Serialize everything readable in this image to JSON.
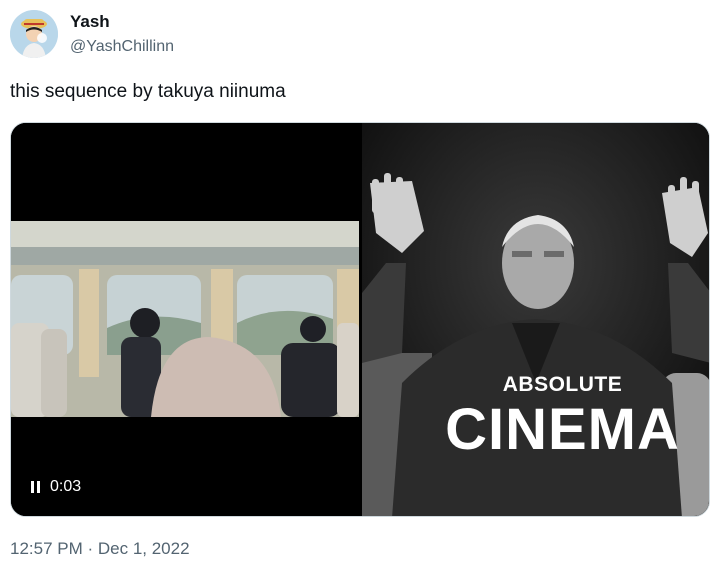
{
  "author": {
    "display_name": "Yash",
    "handle": "@YashChillinn"
  },
  "tweet": {
    "text": "this sequence by takuya niinuma",
    "timestamp": "12:57 PM · Dec 1, 2022"
  },
  "media": {
    "left": {
      "elapsed": "0:03",
      "control_icon": "pause-icon"
    },
    "right": {
      "caption_small": "ABSOLUTE",
      "caption_big": "CINEMA"
    }
  },
  "colors": {
    "text_primary": "#0f1419",
    "text_secondary": "#536471",
    "media_background": "#000000"
  }
}
